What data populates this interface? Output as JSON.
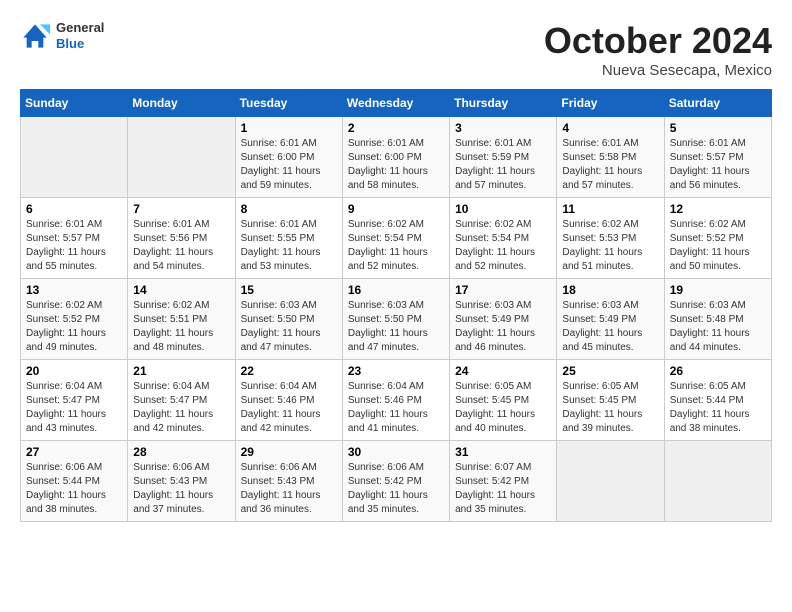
{
  "header": {
    "logo": {
      "general": "General",
      "blue": "Blue"
    },
    "title": "October 2024",
    "location": "Nueva Sesecapa, Mexico"
  },
  "days_of_week": [
    "Sunday",
    "Monday",
    "Tuesday",
    "Wednesday",
    "Thursday",
    "Friday",
    "Saturday"
  ],
  "weeks": [
    [
      {
        "day": "",
        "sunrise": "",
        "sunset": "",
        "daylight": ""
      },
      {
        "day": "",
        "sunrise": "",
        "sunset": "",
        "daylight": ""
      },
      {
        "day": "1",
        "sunrise": "Sunrise: 6:01 AM",
        "sunset": "Sunset: 6:00 PM",
        "daylight": "Daylight: 11 hours and 59 minutes."
      },
      {
        "day": "2",
        "sunrise": "Sunrise: 6:01 AM",
        "sunset": "Sunset: 6:00 PM",
        "daylight": "Daylight: 11 hours and 58 minutes."
      },
      {
        "day": "3",
        "sunrise": "Sunrise: 6:01 AM",
        "sunset": "Sunset: 5:59 PM",
        "daylight": "Daylight: 11 hours and 57 minutes."
      },
      {
        "day": "4",
        "sunrise": "Sunrise: 6:01 AM",
        "sunset": "Sunset: 5:58 PM",
        "daylight": "Daylight: 11 hours and 57 minutes."
      },
      {
        "day": "5",
        "sunrise": "Sunrise: 6:01 AM",
        "sunset": "Sunset: 5:57 PM",
        "daylight": "Daylight: 11 hours and 56 minutes."
      }
    ],
    [
      {
        "day": "6",
        "sunrise": "Sunrise: 6:01 AM",
        "sunset": "Sunset: 5:57 PM",
        "daylight": "Daylight: 11 hours and 55 minutes."
      },
      {
        "day": "7",
        "sunrise": "Sunrise: 6:01 AM",
        "sunset": "Sunset: 5:56 PM",
        "daylight": "Daylight: 11 hours and 54 minutes."
      },
      {
        "day": "8",
        "sunrise": "Sunrise: 6:01 AM",
        "sunset": "Sunset: 5:55 PM",
        "daylight": "Daylight: 11 hours and 53 minutes."
      },
      {
        "day": "9",
        "sunrise": "Sunrise: 6:02 AM",
        "sunset": "Sunset: 5:54 PM",
        "daylight": "Daylight: 11 hours and 52 minutes."
      },
      {
        "day": "10",
        "sunrise": "Sunrise: 6:02 AM",
        "sunset": "Sunset: 5:54 PM",
        "daylight": "Daylight: 11 hours and 52 minutes."
      },
      {
        "day": "11",
        "sunrise": "Sunrise: 6:02 AM",
        "sunset": "Sunset: 5:53 PM",
        "daylight": "Daylight: 11 hours and 51 minutes."
      },
      {
        "day": "12",
        "sunrise": "Sunrise: 6:02 AM",
        "sunset": "Sunset: 5:52 PM",
        "daylight": "Daylight: 11 hours and 50 minutes."
      }
    ],
    [
      {
        "day": "13",
        "sunrise": "Sunrise: 6:02 AM",
        "sunset": "Sunset: 5:52 PM",
        "daylight": "Daylight: 11 hours and 49 minutes."
      },
      {
        "day": "14",
        "sunrise": "Sunrise: 6:02 AM",
        "sunset": "Sunset: 5:51 PM",
        "daylight": "Daylight: 11 hours and 48 minutes."
      },
      {
        "day": "15",
        "sunrise": "Sunrise: 6:03 AM",
        "sunset": "Sunset: 5:50 PM",
        "daylight": "Daylight: 11 hours and 47 minutes."
      },
      {
        "day": "16",
        "sunrise": "Sunrise: 6:03 AM",
        "sunset": "Sunset: 5:50 PM",
        "daylight": "Daylight: 11 hours and 47 minutes."
      },
      {
        "day": "17",
        "sunrise": "Sunrise: 6:03 AM",
        "sunset": "Sunset: 5:49 PM",
        "daylight": "Daylight: 11 hours and 46 minutes."
      },
      {
        "day": "18",
        "sunrise": "Sunrise: 6:03 AM",
        "sunset": "Sunset: 5:49 PM",
        "daylight": "Daylight: 11 hours and 45 minutes."
      },
      {
        "day": "19",
        "sunrise": "Sunrise: 6:03 AM",
        "sunset": "Sunset: 5:48 PM",
        "daylight": "Daylight: 11 hours and 44 minutes."
      }
    ],
    [
      {
        "day": "20",
        "sunrise": "Sunrise: 6:04 AM",
        "sunset": "Sunset: 5:47 PM",
        "daylight": "Daylight: 11 hours and 43 minutes."
      },
      {
        "day": "21",
        "sunrise": "Sunrise: 6:04 AM",
        "sunset": "Sunset: 5:47 PM",
        "daylight": "Daylight: 11 hours and 42 minutes."
      },
      {
        "day": "22",
        "sunrise": "Sunrise: 6:04 AM",
        "sunset": "Sunset: 5:46 PM",
        "daylight": "Daylight: 11 hours and 42 minutes."
      },
      {
        "day": "23",
        "sunrise": "Sunrise: 6:04 AM",
        "sunset": "Sunset: 5:46 PM",
        "daylight": "Daylight: 11 hours and 41 minutes."
      },
      {
        "day": "24",
        "sunrise": "Sunrise: 6:05 AM",
        "sunset": "Sunset: 5:45 PM",
        "daylight": "Daylight: 11 hours and 40 minutes."
      },
      {
        "day": "25",
        "sunrise": "Sunrise: 6:05 AM",
        "sunset": "Sunset: 5:45 PM",
        "daylight": "Daylight: 11 hours and 39 minutes."
      },
      {
        "day": "26",
        "sunrise": "Sunrise: 6:05 AM",
        "sunset": "Sunset: 5:44 PM",
        "daylight": "Daylight: 11 hours and 38 minutes."
      }
    ],
    [
      {
        "day": "27",
        "sunrise": "Sunrise: 6:06 AM",
        "sunset": "Sunset: 5:44 PM",
        "daylight": "Daylight: 11 hours and 38 minutes."
      },
      {
        "day": "28",
        "sunrise": "Sunrise: 6:06 AM",
        "sunset": "Sunset: 5:43 PM",
        "daylight": "Daylight: 11 hours and 37 minutes."
      },
      {
        "day": "29",
        "sunrise": "Sunrise: 6:06 AM",
        "sunset": "Sunset: 5:43 PM",
        "daylight": "Daylight: 11 hours and 36 minutes."
      },
      {
        "day": "30",
        "sunrise": "Sunrise: 6:06 AM",
        "sunset": "Sunset: 5:42 PM",
        "daylight": "Daylight: 11 hours and 35 minutes."
      },
      {
        "day": "31",
        "sunrise": "Sunrise: 6:07 AM",
        "sunset": "Sunset: 5:42 PM",
        "daylight": "Daylight: 11 hours and 35 minutes."
      },
      {
        "day": "",
        "sunrise": "",
        "sunset": "",
        "daylight": ""
      },
      {
        "day": "",
        "sunrise": "",
        "sunset": "",
        "daylight": ""
      }
    ]
  ]
}
